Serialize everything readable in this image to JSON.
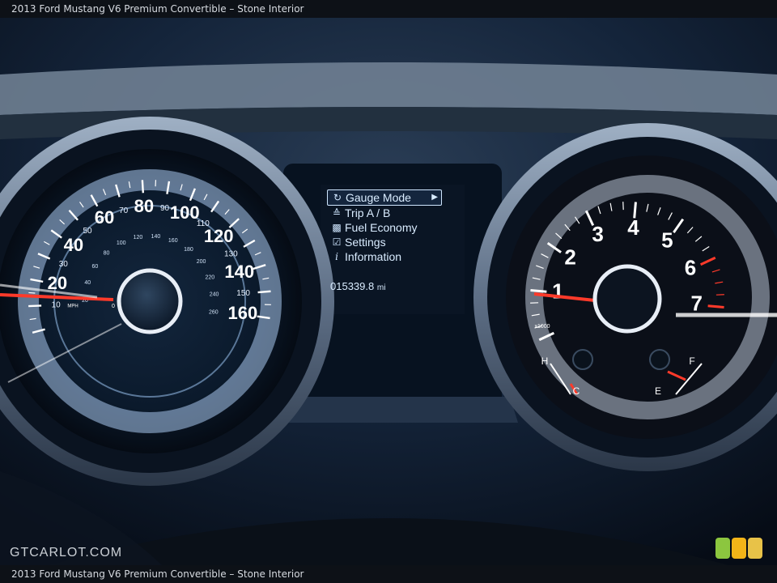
{
  "header": {
    "caption": "2013 Ford Mustang V6 Premium Convertible – Stone Interior"
  },
  "footer": {
    "caption": "2013 Ford Mustang V6 Premium Convertible – Stone Interior"
  },
  "watermark": {
    "text": "GTCARLOT.COM"
  },
  "speedometer": {
    "mph_labels": [
      "20",
      "40",
      "60",
      "80",
      "100",
      "120",
      "140",
      "160"
    ],
    "minor_labels": [
      "10",
      "30",
      "50",
      "70",
      "90",
      "110",
      "130",
      "150"
    ],
    "kmh_labels": [
      "20",
      "40",
      "60",
      "80",
      "100",
      "120",
      "140",
      "160",
      "180",
      "200",
      "220",
      "240",
      "260"
    ],
    "unit": "MPH",
    "zero": "0"
  },
  "tachometer": {
    "labels": [
      "1",
      "2",
      "3",
      "4",
      "5",
      "6",
      "7"
    ],
    "unit": "x1000",
    "temp_labels": {
      "hot": "H",
      "cold": "C"
    },
    "fuel_labels": {
      "full": "F",
      "empty": "E"
    }
  },
  "message_center": {
    "menu": [
      {
        "label": "Gauge Mode",
        "icon": "gauge-icon",
        "selected": true
      },
      {
        "label": "Trip A / B",
        "icon": "trip-icon",
        "selected": false
      },
      {
        "label": "Fuel Economy",
        "icon": "fuel-pump-icon",
        "selected": false
      },
      {
        "label": "Settings",
        "icon": "checkbox-icon",
        "selected": false
      },
      {
        "label": "Information",
        "icon": "info-icon",
        "selected": false
      }
    ],
    "odometer": {
      "value": "015339.8",
      "unit": "mi"
    }
  },
  "colors": {
    "accent_blue": "#cfe6ff",
    "needle_red": "#ff3a2a",
    "gauge_white": "#ffffff",
    "dash_dark": "#0b1624"
  }
}
